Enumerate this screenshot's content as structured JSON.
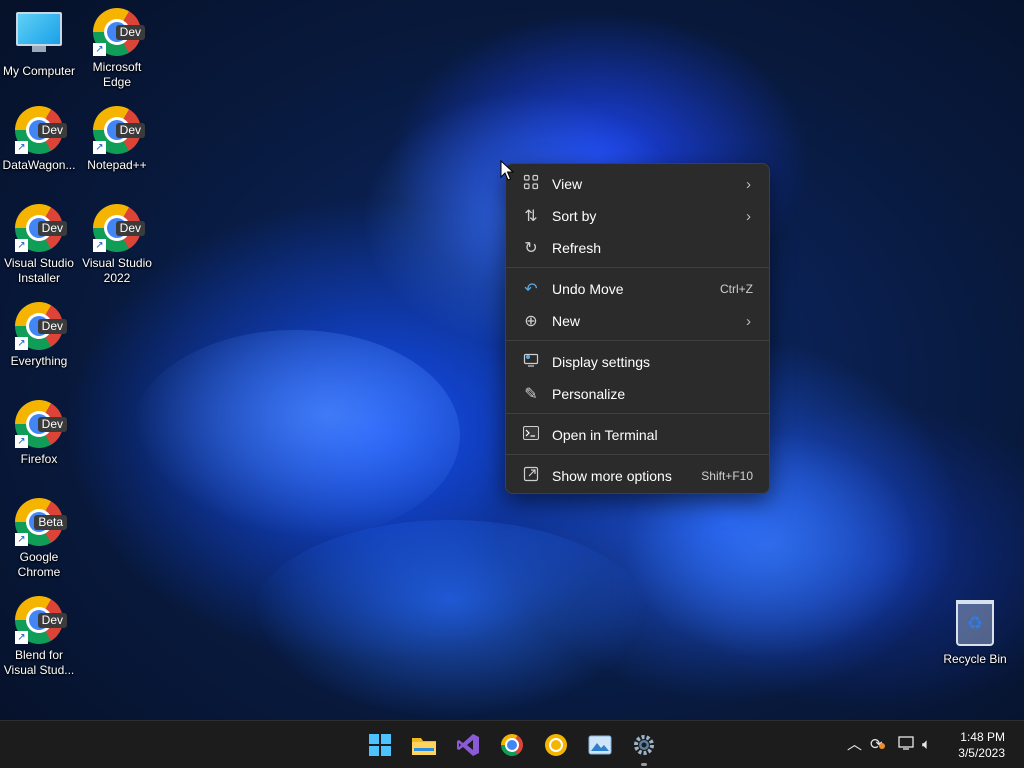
{
  "desktop_icons": [
    {
      "label": "My Computer",
      "icon": "my-computer-icon"
    },
    {
      "label": "Microsoft Edge",
      "badge": "Dev"
    },
    {
      "label": "DataWagon...",
      "badge": "Dev"
    },
    {
      "label": "Notepad++",
      "badge": "Dev"
    },
    {
      "label": "Visual Studio Installer",
      "badge": "Dev"
    },
    {
      "label": "Visual Studio 2022",
      "badge": "Dev"
    },
    {
      "label": "Everything",
      "badge": "Dev"
    },
    {
      "label": "Firefox",
      "badge": "Dev"
    },
    {
      "label": "Google Chrome",
      "badge": "Beta"
    },
    {
      "label": "Blend for Visual Stud...",
      "badge": "Dev"
    },
    {
      "label": "Recycle Bin",
      "icon": "recycle-bin-icon"
    }
  ],
  "context_menu": {
    "items": [
      {
        "label": "View",
        "icon": "grid-icon",
        "has_submenu": true
      },
      {
        "label": "Sort by",
        "icon": "sort-icon",
        "has_submenu": true
      },
      {
        "label": "Refresh",
        "icon": "refresh-icon"
      },
      {
        "label": "Undo Move",
        "icon": "undo-icon",
        "shortcut": "Ctrl+Z"
      },
      {
        "label": "New",
        "icon": "plus-circle-icon",
        "has_submenu": true
      },
      {
        "label": "Display settings",
        "icon": "display-icon"
      },
      {
        "label": "Personalize",
        "icon": "pen-icon"
      },
      {
        "label": "Open in Terminal",
        "icon": "terminal-icon"
      },
      {
        "label": "Show more options",
        "icon": "more-options-icon",
        "shortcut": "Shift+F10"
      }
    ]
  },
  "taskbar": {
    "apps": [
      "start-icon",
      "file-explorer-icon",
      "visual-studio-icon",
      "chrome-icon",
      "chrome-canary-icon",
      "photos-icon",
      "settings-icon"
    ],
    "clock": {
      "time": "1:48 PM",
      "date": "3/5/2023"
    }
  }
}
